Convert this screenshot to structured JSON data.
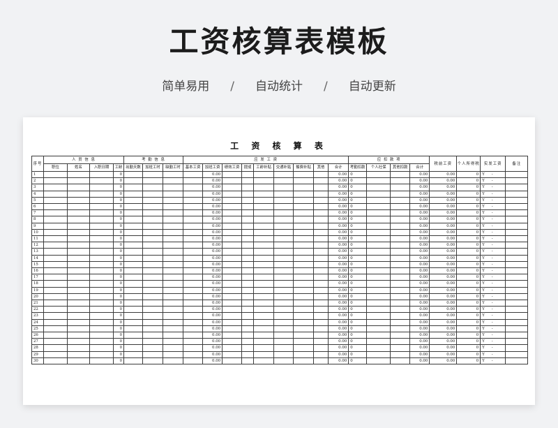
{
  "page_title": "工资核算表模板",
  "subtitle": {
    "items": [
      "简单易用",
      "自动统计",
      "自动更新"
    ],
    "separator": "/"
  },
  "sheet": {
    "title": "工 资 核 算 表",
    "header_groups": {
      "seq": "序号",
      "personnel": "人 员 信 息",
      "attendance": "考 勤 信 息",
      "payable": "应 发 工 资",
      "deduction": "应 扣 款 项",
      "pretax": "税前工资",
      "tax": "个人所得税",
      "netpay": "实发工资",
      "note": "备注"
    },
    "sub_headers": [
      "职位",
      "姓名",
      "入职日期",
      "工龄",
      "出勤天数",
      "加班工时",
      "缺勤工时",
      "基本工资",
      "加班工资",
      "绩效工资",
      "提成",
      "工龄补贴",
      "交通补贴",
      "餐费补贴",
      "其他",
      "合计",
      "考勤扣款",
      "个人社保",
      "其他扣款",
      "合计"
    ],
    "rows_count": 30,
    "default_values": {
      "seniority": "0",
      "overtime_pay": "0.00",
      "payable_total": "0.00",
      "attendance_deduction": "0",
      "deduction_total": "0.00",
      "pretax": "0.00",
      "tax": "0",
      "netpay_currency": "Y",
      "netpay_value": "-"
    }
  }
}
